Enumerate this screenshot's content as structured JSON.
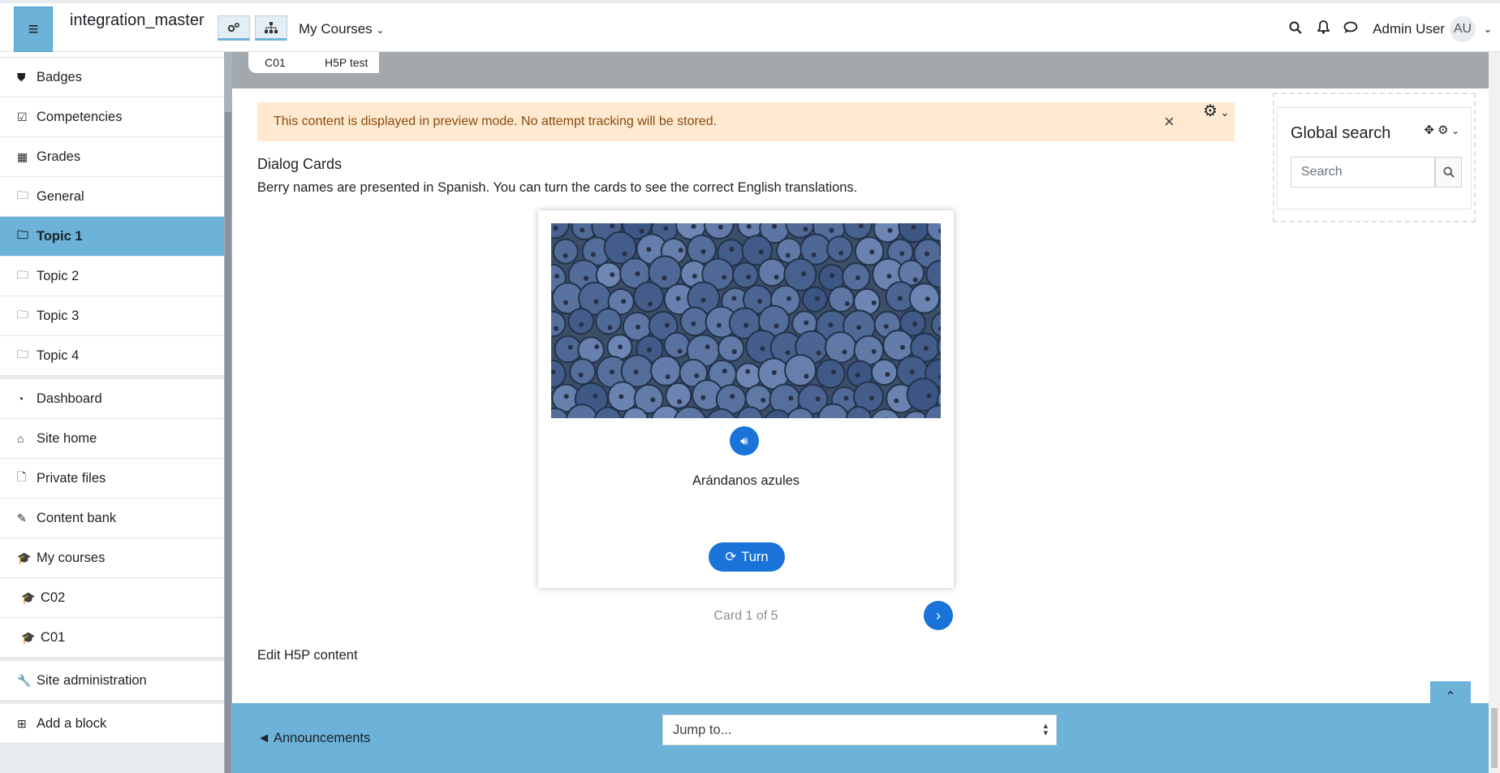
{
  "navbar": {
    "site_name": "integration_master",
    "my_courses": "My Courses",
    "username": "Admin User",
    "avatar_initials": "AU",
    "icons": [
      "hamburger-icon",
      "cogs-icon",
      "sitemap-icon",
      "search-icon",
      "bell-icon",
      "chat-icon"
    ]
  },
  "sidebar": {
    "group1": [
      {
        "label": "Badges",
        "icon": "shield-icon"
      },
      {
        "label": "Competencies",
        "icon": "checkbox-icon"
      },
      {
        "label": "Grades",
        "icon": "table-icon"
      },
      {
        "label": "General",
        "icon": "folder-icon"
      },
      {
        "label": "Topic 1",
        "icon": "folder-icon",
        "active": true
      },
      {
        "label": "Topic 2",
        "icon": "folder-icon"
      },
      {
        "label": "Topic 3",
        "icon": "folder-icon"
      },
      {
        "label": "Topic 4",
        "icon": "folder-icon"
      }
    ],
    "group2": [
      {
        "label": "Dashboard",
        "icon": "dashboard-icon"
      },
      {
        "label": "Site home",
        "icon": "home-icon"
      },
      {
        "label": "Private files",
        "icon": "file-icon"
      },
      {
        "label": "Content bank",
        "icon": "brush-icon"
      },
      {
        "label": "My courses",
        "icon": "graduation-cap-icon"
      },
      {
        "label": "C02",
        "icon": "graduation-cap-icon"
      },
      {
        "label": "C01",
        "icon": "graduation-cap-icon"
      }
    ],
    "site_admin": "Site administration",
    "add_block": "Add a block"
  },
  "breadcrumb": [
    "C01",
    "H5P test"
  ],
  "alert": {
    "message": "This content is displayed in preview mode. No attempt tracking will be stored.",
    "close": "×",
    "color_bg": "#ffe9d0"
  },
  "h5p": {
    "title": "Dialog Cards",
    "description": "Berry names are presented in Spanish. You can turn the cards to see the correct English translations.",
    "card_text": "Arándanos azules",
    "turn_label": "Turn",
    "card_count": "Card 1 of 5",
    "edit_link": "Edit H5P content",
    "accent": "#1a73d9"
  },
  "block": {
    "title": "Global search",
    "search_placeholder": "Search"
  },
  "footer": {
    "prev_link": "◄ Announcements",
    "jump_to": "Jump to..."
  }
}
